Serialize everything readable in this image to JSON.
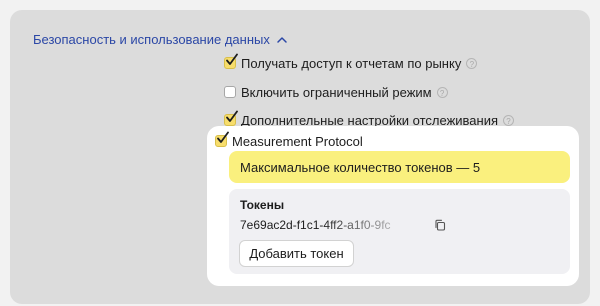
{
  "section": {
    "title": "Безопасность и использование данных",
    "chevron_icon": "chevron-up-icon"
  },
  "options": [
    {
      "label": "Получать доступ к отчетам по рынку",
      "checked": true,
      "help": true
    },
    {
      "label": "Включить ограниченный режим",
      "checked": false,
      "help": true
    },
    {
      "label": "Дополнительные настройки отслеживания",
      "checked": true,
      "help": true
    }
  ],
  "measurement": {
    "label": "Measurement Protocol",
    "checked": true,
    "warning": "Максимальное количество токенов — 5",
    "tokens_title": "Токены",
    "token_value": "7e69ac2d-f1c1-4ff2-a1f0-9fc",
    "copy_icon": "copy-icon",
    "add_button": "Добавить токен"
  },
  "colors": {
    "accent_link": "#2b47a6",
    "checkbox_checked": "#f7dd6c",
    "warning_bg": "#faf07e"
  }
}
